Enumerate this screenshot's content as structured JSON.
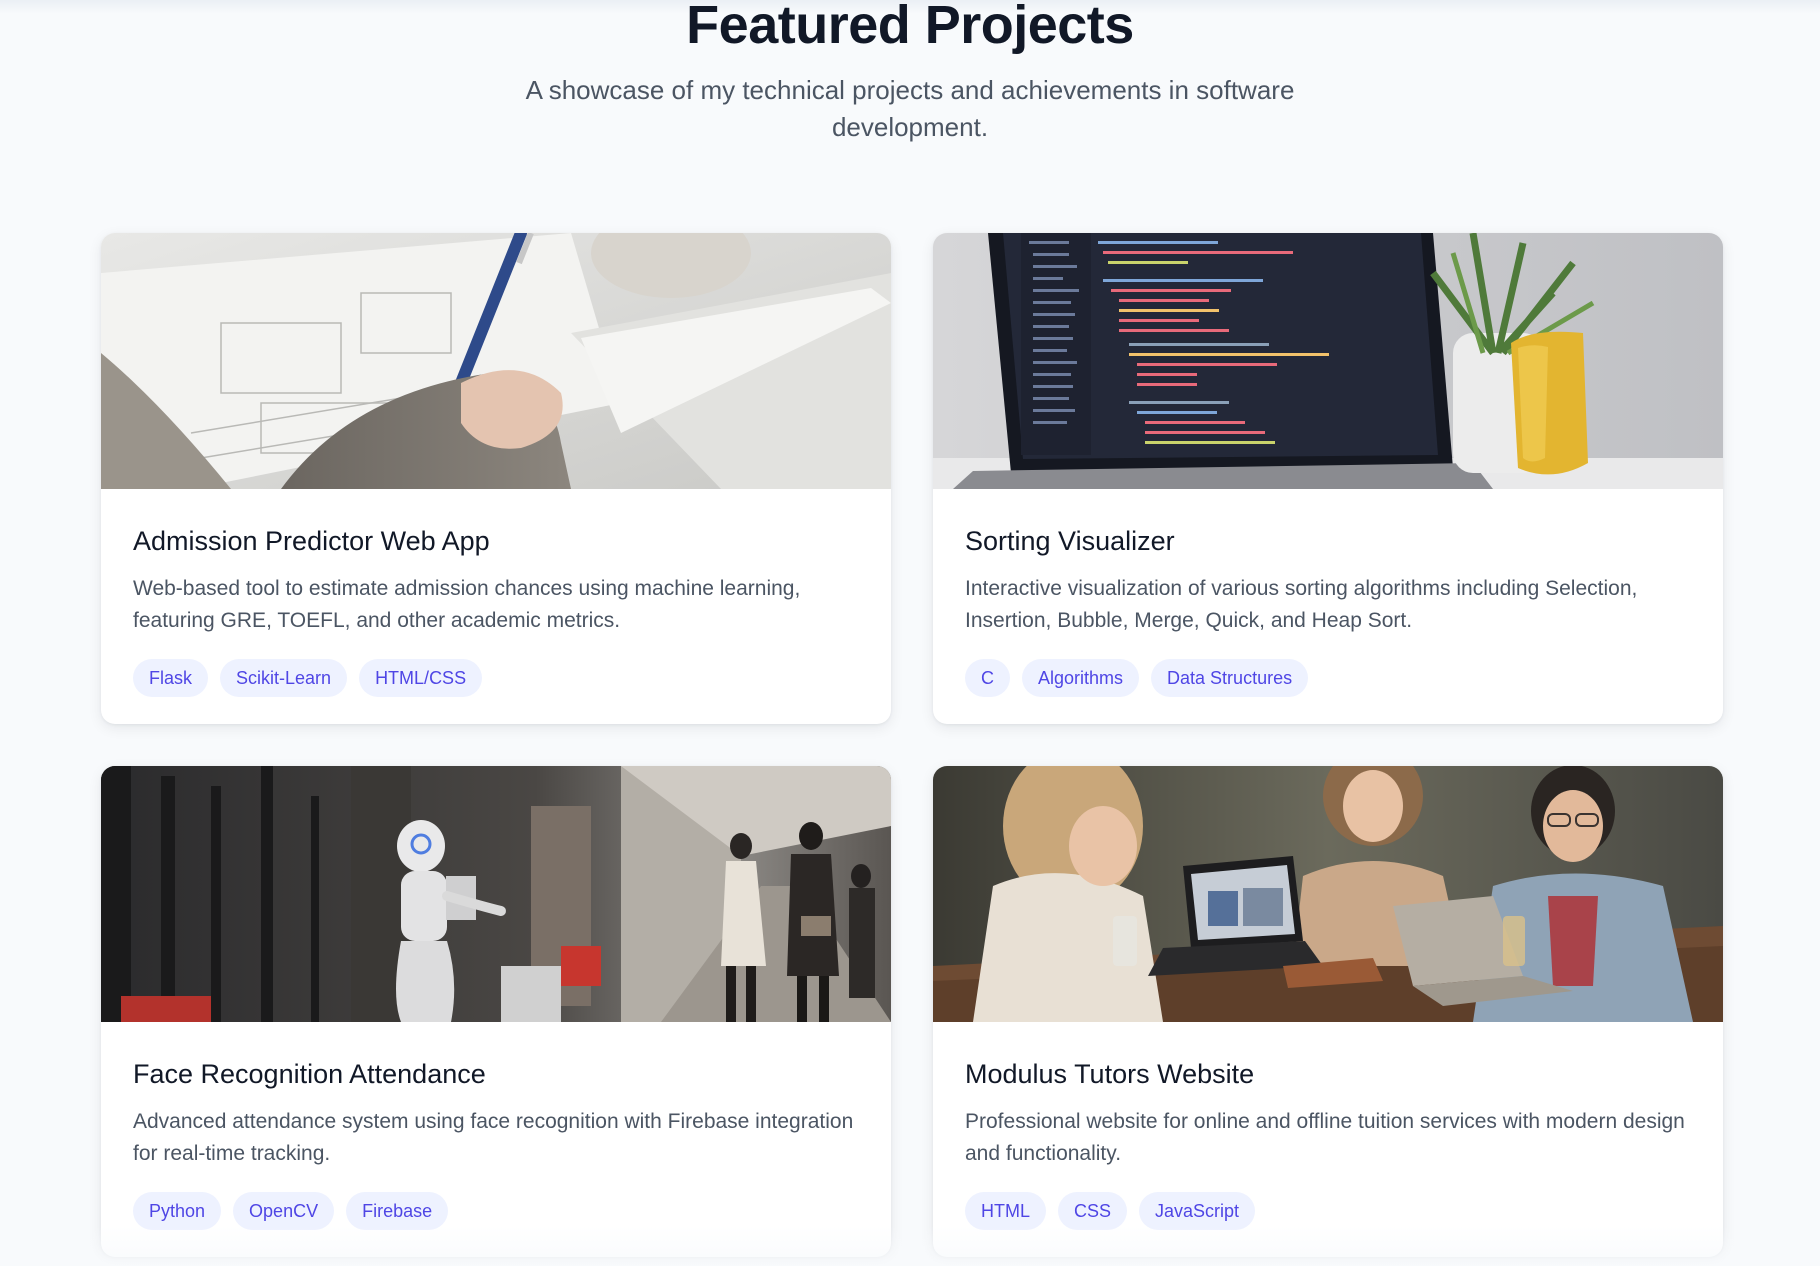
{
  "section": {
    "title": "Featured Projects",
    "subtitle": "A showcase of my technical projects and achievements in software development."
  },
  "projects": [
    {
      "title": "Admission Predictor Web App",
      "description": "Web-based tool to estimate admission chances using machine learning, featuring GRE, TOEFL, and other academic metrics.",
      "tags": [
        "Flask",
        "Scikit-Learn",
        "HTML/CSS"
      ]
    },
    {
      "title": "Sorting Visualizer",
      "description": "Interactive visualization of various sorting algorithms including Selection, Insertion, Bubble, Merge, Quick, and Heap Sort.",
      "tags": [
        "C",
        "Algorithms",
        "Data Structures"
      ]
    },
    {
      "title": "Face Recognition Attendance",
      "description": "Advanced attendance system using face recognition with Firebase integration for real-time tracking.",
      "tags": [
        "Python",
        "OpenCV",
        "Firebase"
      ]
    },
    {
      "title": "Modulus Tutors Website",
      "description": "Professional website for online and offline tuition services with modern design and functionality.",
      "tags": [
        "HTML",
        "CSS",
        "JavaScript"
      ]
    }
  ],
  "colors": {
    "background": "#f8fafc",
    "card": "#ffffff",
    "title": "#111827",
    "text": "#4b5563",
    "tag_bg": "#eef2ff",
    "tag_text": "#4f46e5"
  }
}
